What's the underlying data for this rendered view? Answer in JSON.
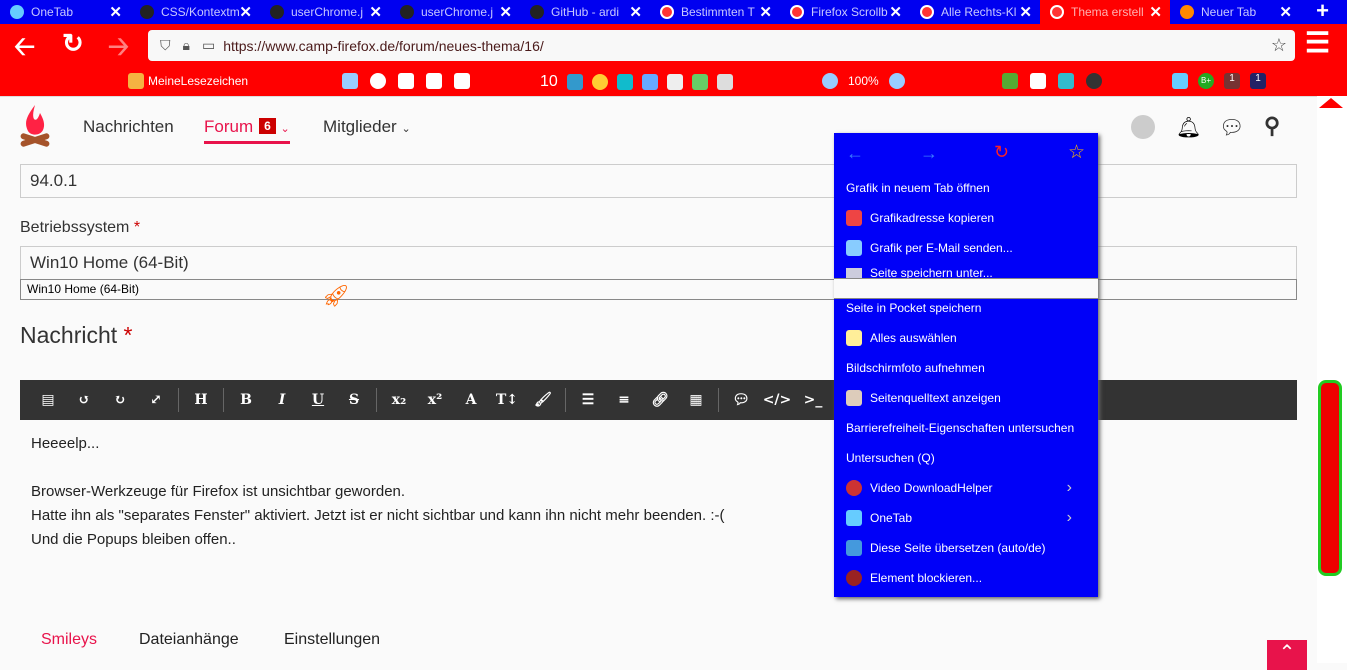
{
  "tabs": [
    {
      "label": "OneTab",
      "color": "#6cf"
    },
    {
      "label": "CSS/Kontextm",
      "color": "#222"
    },
    {
      "label": "userChrome.j",
      "color": "#222"
    },
    {
      "label": "userChrome.j",
      "color": "#222"
    },
    {
      "label": "GitHub - ardi",
      "color": "#222"
    },
    {
      "label": "Bestimmten T",
      "color": "#f33"
    },
    {
      "label": "Firefox Scrollb",
      "color": "#f33"
    },
    {
      "label": "Alle Rechts-Kl",
      "color": "#f33"
    },
    {
      "label": "Thema erstell",
      "color": "#f33"
    },
    {
      "label": "Neuer Tab",
      "color": "#f80"
    }
  ],
  "new_tab": "+",
  "url": "https://www.camp-firefox.de/forum/neues-thema/16/",
  "bookmarks": {
    "folder": "MeineLesezeichen",
    "counter": "10",
    "zoom": "100%",
    "badge1": "1",
    "badge2": "1",
    "bplus": "B+"
  },
  "site": {
    "nav": [
      "Nachrichten",
      "Forum",
      "Mitglieder"
    ],
    "forum_badge": "6"
  },
  "form": {
    "version_value": "94.0.1",
    "os_label": "Betriebssystem",
    "required": "*",
    "os_value": "Win10 Home (64-Bit)",
    "autocomplete": "Win10 Home (64-Bit)",
    "message_label": "Nachricht"
  },
  "editor": {
    "lines": [
      "Heeeelp...",
      "",
      "Browser-Werkzeuge für Firefox ist unsichtbar geworden.",
      "Hatte ihn als \"separates Fenster\" aktiviert. Jetzt ist er nicht sichtbar und kann ihn nicht mehr beenden. :-(",
      "Und die Popups bleiben offen.."
    ]
  },
  "bottom_tabs": [
    "Smileys",
    "Dateianhänge",
    "Einstellungen"
  ],
  "context_menu": {
    "items": [
      "Grafik in neuem Tab öffnen",
      "Grafikadresse kopieren",
      "Grafik per E-Mail senden...",
      "Seite speichern unter...",
      "Seite in Pocket speichern",
      "Alles auswählen",
      "Bildschirmfoto aufnehmen",
      "Seitenquelltext anzeigen",
      "Barrierefreiheit-Eigenschaften untersuchen",
      "Untersuchen (Q)",
      "Video DownloadHelper",
      "OneTab",
      "Diese Seite übersetzen (auto/de)",
      "Element blockieren..."
    ]
  }
}
